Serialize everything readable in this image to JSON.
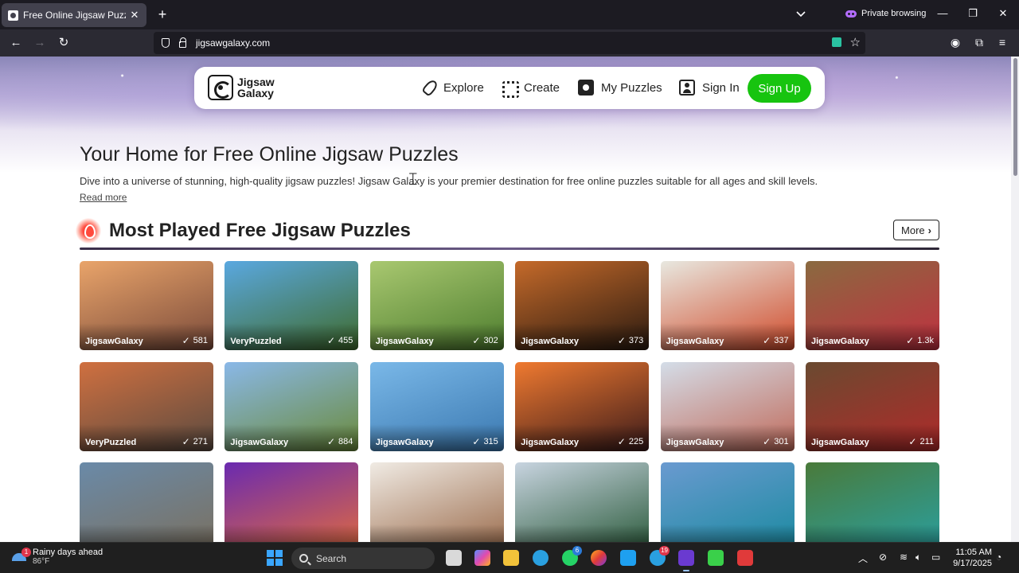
{
  "browser": {
    "tab_title": "Free Online Jigsaw Puzzles for All",
    "new_tab": "+",
    "private_label": "Private browsing",
    "url": "jigsawgalaxy.com"
  },
  "site": {
    "logo_line1": "Jigsaw",
    "logo_line2": "Galaxy",
    "nav": {
      "explore": "Explore",
      "create": "Create",
      "my_puzzles": "My Puzzles",
      "sign_in": "Sign In",
      "sign_up": "Sign Up"
    }
  },
  "hero": {
    "title": "Your Home for Free Online Jigsaw Puzzles",
    "description": "Dive into a universe of stunning, high-quality jigsaw puzzles! Jigsaw Galaxy is your premier destination for free online puzzles suitable for all ages and skill levels.",
    "read_more": "Read more"
  },
  "section": {
    "title": "Most Played Free Jigsaw Puzzles",
    "more": "More"
  },
  "puzzles": [
    {
      "author": "JigsawGalaxy",
      "plays": "581",
      "colors": [
        "#e9a46a",
        "#7a4a3a"
      ]
    },
    {
      "author": "VeryPuzzled",
      "plays": "455",
      "colors": [
        "#5aa8e0",
        "#3f6b2c"
      ]
    },
    {
      "author": "JigsawGalaxy",
      "plays": "302",
      "colors": [
        "#a9c870",
        "#4d7d2e"
      ]
    },
    {
      "author": "JigsawGalaxy",
      "plays": "373",
      "colors": [
        "#c56a2a",
        "#2a1a10"
      ]
    },
    {
      "author": "JigsawGalaxy",
      "plays": "337",
      "colors": [
        "#e8e8e0",
        "#d04a2a"
      ]
    },
    {
      "author": "JigsawGalaxy",
      "plays": "1.3k",
      "colors": [
        "#8a6a40",
        "#c03040"
      ]
    },
    {
      "author": "VeryPuzzled",
      "plays": "271",
      "colors": [
        "#d07040",
        "#5a4a40"
      ]
    },
    {
      "author": "JigsawGalaxy",
      "plays": "884",
      "colors": [
        "#8ab8e8",
        "#6a8a3a"
      ]
    },
    {
      "author": "JigsawGalaxy",
      "plays": "315",
      "colors": [
        "#7ab8e8",
        "#3a78b0"
      ]
    },
    {
      "author": "JigsawGalaxy",
      "plays": "225",
      "colors": [
        "#f07a30",
        "#3a1a1a"
      ]
    },
    {
      "author": "JigsawGalaxy",
      "plays": "301",
      "colors": [
        "#d4dde8",
        "#c06a5a"
      ]
    },
    {
      "author": "JigsawGalaxy",
      "plays": "211",
      "colors": [
        "#6a4a30",
        "#b02a2a"
      ]
    },
    {
      "author": "",
      "plays": "",
      "colors": [
        "#6a8aa8",
        "#7a7060"
      ]
    },
    {
      "author": "",
      "plays": "",
      "colors": [
        "#6a2ab0",
        "#e06a40"
      ]
    },
    {
      "author": "",
      "plays": "",
      "colors": [
        "#f0ebe4",
        "#9a6a4a"
      ]
    },
    {
      "author": "",
      "plays": "",
      "colors": [
        "#c8d4e0",
        "#2a5a3a"
      ]
    },
    {
      "author": "",
      "plays": "",
      "colors": [
        "#6a9ad0",
        "#1a8aa0"
      ]
    },
    {
      "author": "",
      "plays": "",
      "colors": [
        "#4a7a3a",
        "#2aa0a0"
      ]
    }
  ],
  "taskbar": {
    "weather_title": "Rainy days ahead",
    "weather_temp": "86°F",
    "weather_badge": "1",
    "search_placeholder": "Search",
    "whatsapp_badge": "6",
    "telegram_badge": "19",
    "time": "11:05 AM",
    "date": "9/17/2025"
  },
  "colors": {
    "signup": "#17c40f",
    "tab_bg": "#42414d",
    "chrome_dark": "#1c1b22"
  }
}
